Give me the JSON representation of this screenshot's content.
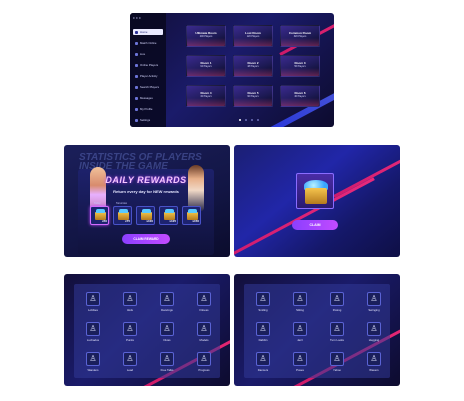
{
  "main_menu": {
    "app_title": "≡ ≡ ≡",
    "items": [
      {
        "label": "Home",
        "active": true
      },
      {
        "label": "Match Online"
      },
      {
        "label": "Live"
      },
      {
        "label": "Online Players"
      },
      {
        "label": "Player Activity"
      },
      {
        "label": "Search Players"
      },
      {
        "label": "Messages"
      },
      {
        "label": "My Profile"
      },
      {
        "label": "Settings"
      }
    ],
    "rooms": [
      {
        "title": "Ultimate Room",
        "sub": "200 Players"
      },
      {
        "title": "Lost Room",
        "sub": "120 Players"
      },
      {
        "title": "Common Room",
        "sub": "320 Players"
      },
      {
        "title": "Room 1",
        "sub": "64 Players"
      },
      {
        "title": "Room 2",
        "sub": "48 Players"
      },
      {
        "title": "Room 3",
        "sub": "56 Players"
      },
      {
        "title": "Room 4",
        "sub": "32 Players"
      },
      {
        "title": "Room 5",
        "sub": "90 Players"
      },
      {
        "title": "Room 6",
        "sub": "40 Players"
      }
    ]
  },
  "daily_rewards": {
    "bg_text": "STATISTICS OF PLAYERS INSIDE THE GAME",
    "title": "DAILY REWARDS",
    "subtitle": "Return every day for NEW rewards",
    "day_labels": [
      "Today",
      "Tomorrow"
    ],
    "days": [
      {
        "amount": "x50",
        "current": true
      },
      {
        "amount": "x75"
      },
      {
        "amount": "x100"
      },
      {
        "amount": "x125"
      },
      {
        "amount": "x150"
      }
    ],
    "claim_label": "CLAIM REWARD"
  },
  "claim_screen": {
    "claim_label": "CLAIM"
  },
  "icon_grid_1": [
    {
      "icon": "figure-icon",
      "glyph": "🯅",
      "label": "Lobbies"
    },
    {
      "icon": "figure-icon",
      "glyph": "🯆",
      "label": "Idols"
    },
    {
      "icon": "figure-icon",
      "glyph": "🯇",
      "label": "Dancings"
    },
    {
      "icon": "figure-icon",
      "glyph": "🯈",
      "label": "Fitness"
    },
    {
      "icon": "figure-icon",
      "glyph": "🯅",
      "label": "Luchados"
    },
    {
      "icon": "figure-icon",
      "glyph": "🯆",
      "label": "Punks"
    },
    {
      "icon": "figure-icon",
      "glyph": "🯇",
      "label": "Divas"
    },
    {
      "icon": "figure-icon",
      "glyph": "🯈",
      "label": "Models"
    },
    {
      "icon": "figure-icon",
      "glyph": "🯅",
      "label": "Wanders"
    },
    {
      "icon": "figure-icon",
      "glyph": "🯆",
      "label": "Lead"
    },
    {
      "icon": "figure-icon",
      "glyph": "🯇",
      "label": "Free Talks"
    },
    {
      "icon": "figure-icon",
      "glyph": "🯈",
      "label": "Progress"
    }
  ],
  "icon_grid_2": [
    {
      "icon": "figure-icon",
      "glyph": "🯅",
      "label": "Smiling"
    },
    {
      "icon": "figure-icon",
      "glyph": "🯆",
      "label": "Sitting"
    },
    {
      "icon": "figure-icon",
      "glyph": "🯇",
      "label": "Posing"
    },
    {
      "icon": "figure-icon",
      "glyph": "🯈",
      "label": "Swinging"
    },
    {
      "icon": "figure-icon",
      "glyph": "🯅",
      "label": "Dabbin"
    },
    {
      "icon": "figure-icon",
      "glyph": "🯆",
      "label": "Jazz"
    },
    {
      "icon": "figure-icon",
      "glyph": "🯇",
      "label": "Turn Looks"
    },
    {
      "icon": "figure-icon",
      "glyph": "🯈",
      "label": "Hugging"
    },
    {
      "icon": "figure-icon",
      "glyph": "🯅",
      "label": "Dancers"
    },
    {
      "icon": "figure-icon",
      "glyph": "🯆",
      "label": "Poses"
    },
    {
      "icon": "figure-icon",
      "glyph": "🯇",
      "label": "Yahoo"
    },
    {
      "icon": "figure-icon",
      "glyph": "🯈",
      "label": "Wavers"
    }
  ]
}
